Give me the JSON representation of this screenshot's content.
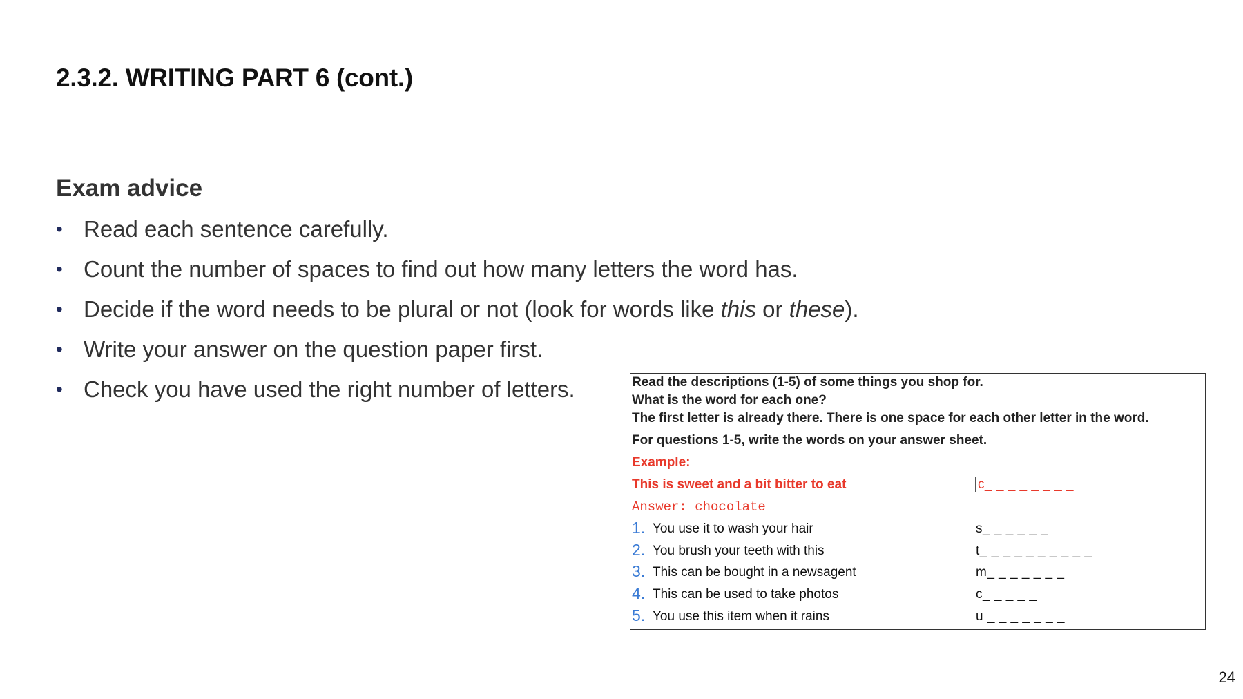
{
  "slide": {
    "title": "2.3.2. WRITING PART 6 (cont.)",
    "page_number": "24"
  },
  "advice": {
    "heading": "Exam advice",
    "bullet_glyph": "•",
    "items": [
      {
        "text": "Read each sentence carefully."
      },
      {
        "text": "Count the number of spaces to find out how many letters the word has."
      },
      {
        "pre": "Decide if the word needs to be plural or not (look for words like ",
        "em1": "this",
        "mid": " or ",
        "em2": "these",
        "post": ")."
      },
      {
        "text": "Write your answer on the question paper first."
      },
      {
        "text": "Check you have used the right number of letters."
      }
    ]
  },
  "example_box": {
    "instructions": [
      "Read the descriptions (1-5) of some things you shop for.",
      "What is the word for each one?",
      "The first letter is already there. There is one space for each other letter in the word.",
      "For questions 1-5, write the words on your answer sheet."
    ],
    "example_label": "Example:",
    "example_sentence": "This is sweet and a bit bitter to eat",
    "example_blank": "c_ _ _ _ _ _ _ _",
    "answer_line": "Answer: chocolate",
    "questions": [
      {
        "number": "1.",
        "text": "You use it to wash your hair",
        "blank": "s_ _ _ _ _ _"
      },
      {
        "number": "2.",
        "text": "You brush your teeth with this",
        "blank": "t_ _ _ _ _ _ _ _ _ _"
      },
      {
        "number": "3.",
        "text": "This can be bought in a newsagent",
        "blank": "m_ _ _ _ _ _ _"
      },
      {
        "number": "4.",
        "text": "This can be used to take photos",
        "blank": "c_ _ _ _ _"
      },
      {
        "number": "5.",
        "text": "You use this item when it rains",
        "blank": "u _ _ _ _ _ _ _"
      }
    ]
  },
  "colors": {
    "example_red": "#e8392b",
    "question_number_blue": "#3a7bd5",
    "bullet_navy": "#1f2a5c"
  }
}
